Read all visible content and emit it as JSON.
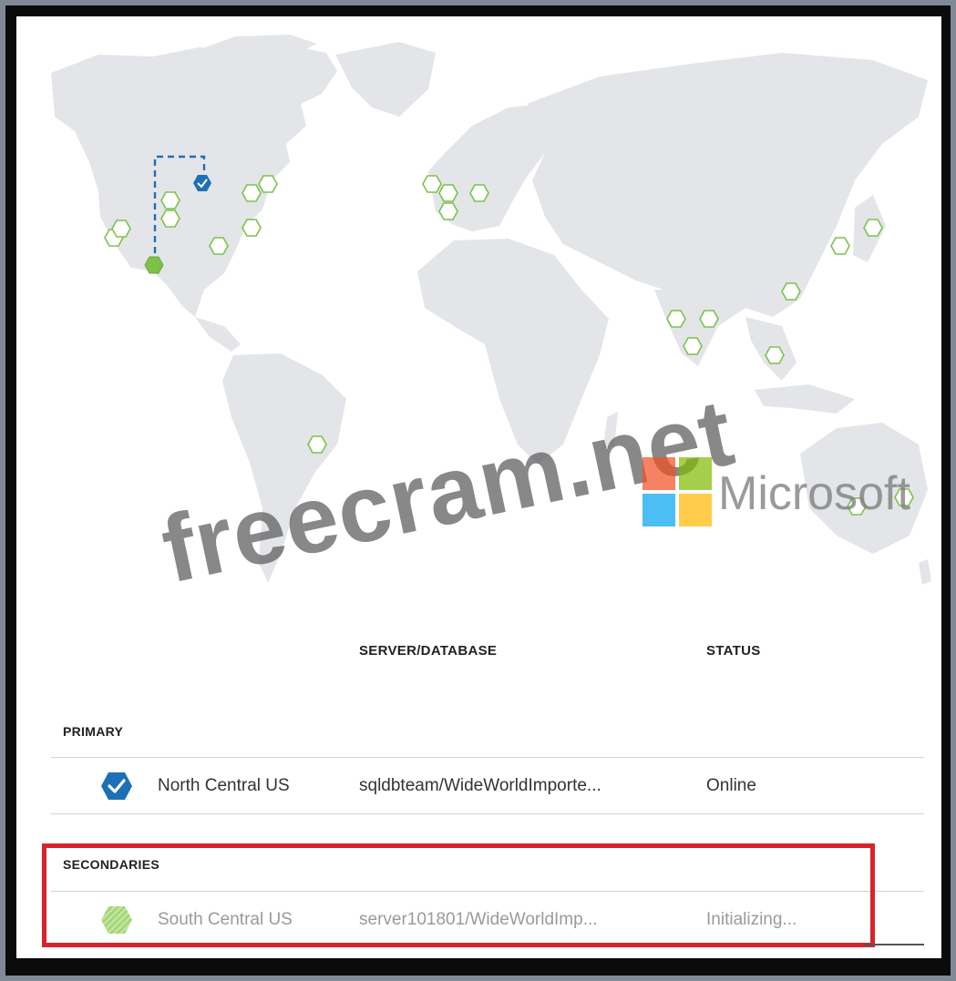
{
  "watermark": {
    "text": "freecram.net",
    "brand": "Microsoft",
    "logo_colors": [
      "#f25022",
      "#7fba00",
      "#00a4ef",
      "#ffb900"
    ]
  },
  "map": {
    "icons": {
      "primary": "primary-check-hex-icon",
      "secondary": "secondary-filled-hex-icon",
      "region": "region-hex-icon"
    },
    "colors": {
      "land": "#e3e5e8",
      "region_stroke": "#7cc24a",
      "primary": "#1f6fb5",
      "link": "#1f6fb5"
    }
  },
  "table": {
    "headers": {
      "server_database": "SERVER/DATABASE",
      "status": "STATUS"
    },
    "primary": {
      "section_label": "PRIMARY",
      "region": "North Central US",
      "server_database": "sqldbteam/WideWorldImporte...",
      "status": "Online",
      "icon": "primary-check-icon"
    },
    "secondaries": {
      "section_label": "SECONDARIES",
      "rows": [
        {
          "region": "South Central US",
          "server_database": "server101801/WideWorldImp...",
          "status": "Initializing...",
          "icon": "secondary-hatched-hex-icon"
        }
      ]
    }
  },
  "colors": {
    "highlight_border": "#d9232c",
    "accent_blue": "#1f6fb5",
    "accent_green": "#7cc24a"
  }
}
